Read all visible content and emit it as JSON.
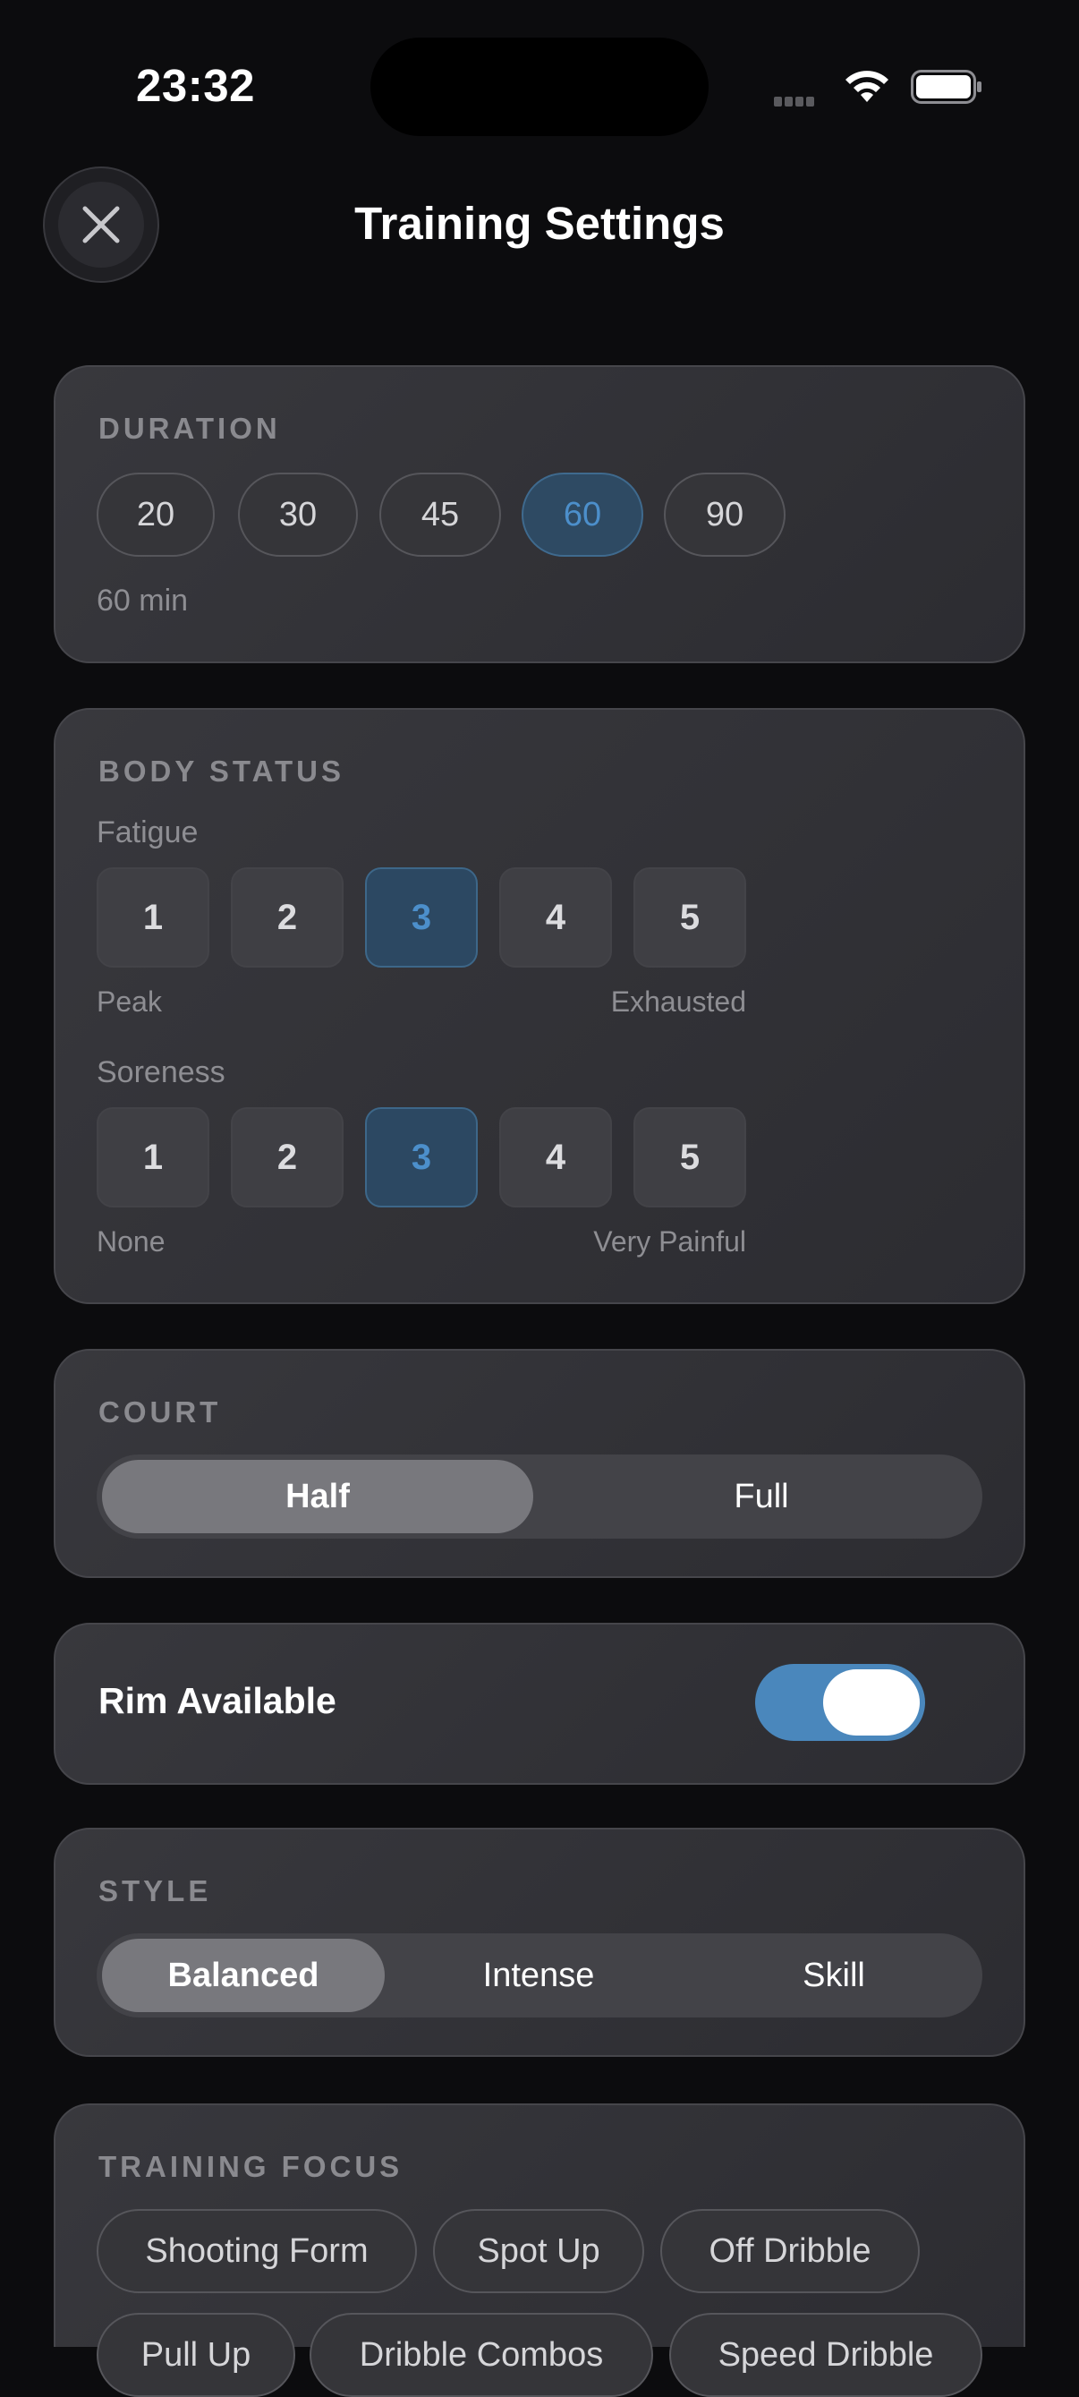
{
  "status_bar": {
    "time": "23:32",
    "icons": [
      "cellular-icon",
      "wifi-icon",
      "battery-icon"
    ]
  },
  "header": {
    "title": "Training Settings",
    "close_icon": "close-icon"
  },
  "duration": {
    "title": "DURATION",
    "options": [
      "20",
      "30",
      "45",
      "60",
      "90"
    ],
    "selected": "60",
    "summary": "60 min"
  },
  "body_status": {
    "title": "BODY STATUS",
    "fatigue": {
      "label": "Fatigue",
      "options": [
        "1",
        "2",
        "3",
        "4",
        "5"
      ],
      "selected": "3",
      "low_label": "Peak",
      "high_label": "Exhausted"
    },
    "soreness": {
      "label": "Soreness",
      "options": [
        "1",
        "2",
        "3",
        "4",
        "5"
      ],
      "selected": "3",
      "low_label": "None",
      "high_label": "Very Painful"
    }
  },
  "court": {
    "title": "COURT",
    "options": [
      "Half",
      "Full"
    ],
    "selected": "Half"
  },
  "rim": {
    "label": "Rim Available",
    "enabled": true
  },
  "style": {
    "title": "STYLE",
    "options": [
      "Balanced",
      "Intense",
      "Skill"
    ],
    "selected": "Balanced"
  },
  "training_focus": {
    "title": "TRAINING FOCUS",
    "chips": [
      "Shooting Form",
      "Spot Up",
      "Off Dribble",
      "Pull Up",
      "Dribble Combos",
      "Speed Dribble"
    ]
  },
  "colors": {
    "background": "#0c0c0e",
    "card": "#333338",
    "accent": "#4a87bc",
    "selected_segment": "#78787d"
  }
}
